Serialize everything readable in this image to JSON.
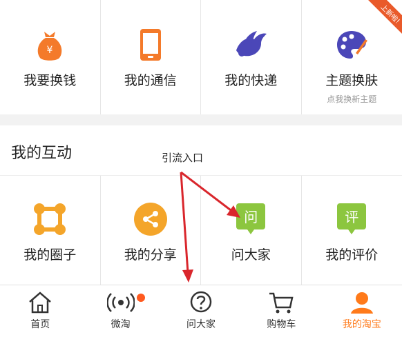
{
  "top_grid": {
    "items": [
      {
        "label": "我要换钱",
        "icon": "money-bag-icon"
      },
      {
        "label": "我的通信",
        "icon": "phone-icon"
      },
      {
        "label": "我的快递",
        "icon": "bird-icon"
      },
      {
        "label": "主题换肤",
        "sub": "点我换新主题",
        "ribbon": "上新啦!",
        "icon": "palette-icon"
      }
    ]
  },
  "interaction": {
    "title": "我的互动",
    "annotation": "引流入口",
    "items": [
      {
        "label": "我的圈子",
        "icon": "circle-icon"
      },
      {
        "label": "我的分享",
        "icon": "share-icon"
      },
      {
        "label": "问大家",
        "icon_text": "问",
        "icon": "ask-icon"
      },
      {
        "label": "我的评价",
        "icon_text": "评",
        "icon": "review-icon"
      }
    ]
  },
  "tabbar": {
    "tabs": [
      {
        "label": "首页",
        "icon": "home-icon"
      },
      {
        "label": "微淘",
        "icon": "broadcast-icon"
      },
      {
        "label": "问大家",
        "icon": "question-icon"
      },
      {
        "label": "购物车",
        "icon": "cart-icon"
      },
      {
        "label": "我的淘宝",
        "icon": "user-icon",
        "active": true
      }
    ]
  },
  "colors": {
    "orange": "#f47a2a",
    "purple": "#4b47b8",
    "green": "#8cc63f",
    "active_tab": "#ff7a1a",
    "arrow": "#d9262c"
  }
}
